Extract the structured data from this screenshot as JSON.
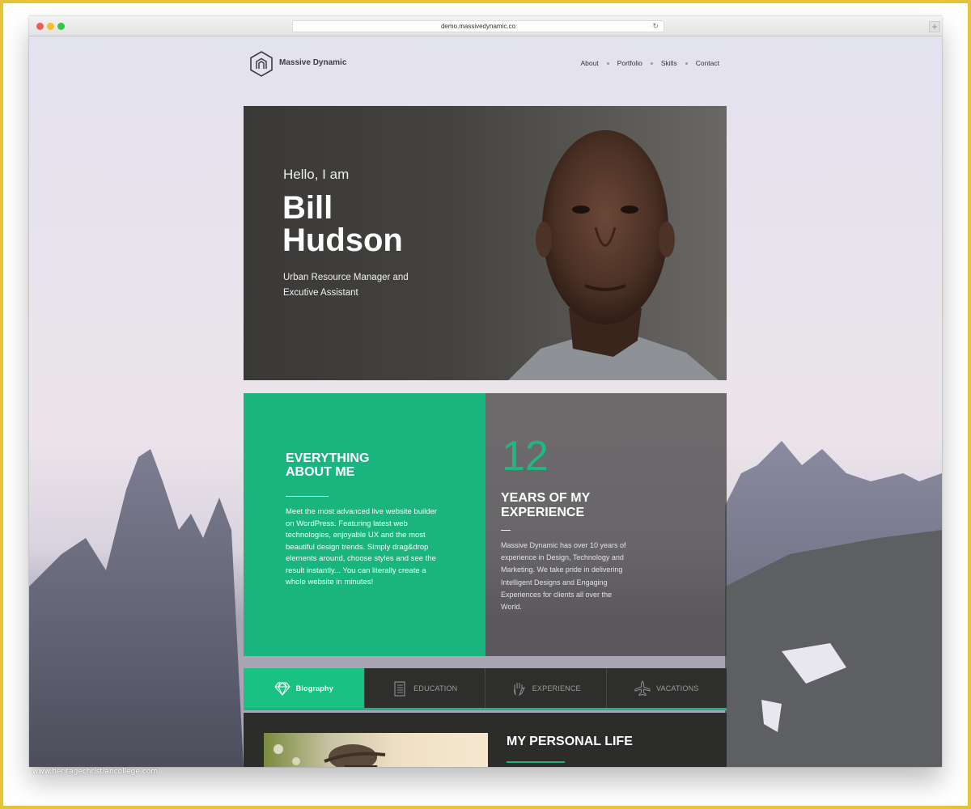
{
  "browser": {
    "url": "demo.massivedynamic.co",
    "reload_icon": "↻",
    "new_tab_icon": "+"
  },
  "site": {
    "logo_text": "Massive Dynamic",
    "nav": [
      {
        "label": "About"
      },
      {
        "label": "Portfolio"
      },
      {
        "label": "Skills"
      },
      {
        "label": "Contact"
      }
    ]
  },
  "hero": {
    "greeting": "Hello, I am",
    "first_name": "Bill",
    "last_name": "Hudson",
    "role_line1": "Urban Resource Manager and",
    "role_line2": "Excutive Assistant"
  },
  "about": {
    "title_line1": "EVERYTHING",
    "title_line2": "ABOUT ME",
    "text": "Meet the most advanced live website builder on WordPress. Featuring latest web technologies, enjoyable UX and the most beautiful design trends. Simply drag&drop elements around, choose styles and see the result instantly... You can literally create a whole website in minutes!"
  },
  "experience": {
    "number": "12",
    "title_line1": "YEARS OF MY",
    "title_line2": "EXPERIENCE",
    "text": "Massive Dynamic has over 10 years of experience in Design, Technology and Marketing. We take pride in delivering Intelligent Designs and Engaging Experiences for clients all over the World."
  },
  "tabs": [
    {
      "label": "Biography",
      "icon": "diamond-icon",
      "active": true
    },
    {
      "label": "EDUCATION",
      "icon": "clipboard-icon",
      "active": false
    },
    {
      "label": "EXPERIENCE",
      "icon": "hand-icon",
      "active": false
    },
    {
      "label": "VACATIONS",
      "icon": "airplane-icon",
      "active": false
    }
  ],
  "biography": {
    "title": "MY PERSONAL LIFE"
  },
  "watermark": "www.heritagechristiancollege.com",
  "colors": {
    "accent": "#1ab47f",
    "frame": "#e4c53a"
  }
}
